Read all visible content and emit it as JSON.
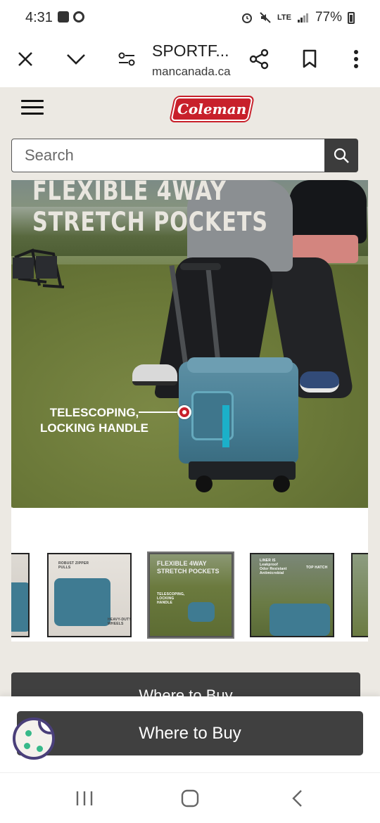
{
  "status_bar": {
    "time": "4:31",
    "network": "LTE",
    "battery": "77%"
  },
  "browser": {
    "page_title": "SPORTF...",
    "url": "mancanada.ca"
  },
  "site": {
    "brand": "Coleman",
    "brand_color": "#c8202b",
    "search_placeholder": "Search"
  },
  "hero": {
    "headline_line1": "FLEXIBLE 4WAY",
    "headline_line2": "STRETCH POCKETS",
    "callout_line1": "TELESCOPING,",
    "callout_line2": "LOCKING HANDLE"
  },
  "thumbnails": [
    {
      "label_1": "",
      "label_2": "",
      "label_3": ""
    },
    {
      "label_1": "ROBUST ZIPPER PULLS",
      "label_2": "HEAVY-DUTY WHEELS"
    },
    {
      "label_1": "FLEXIBLE 4WAY",
      "label_2": "STRETCH POCKETS",
      "label_3": "TELESCOPING, LOCKING HANDLE"
    },
    {
      "label_1": "LINER IS",
      "label_2": "Leakproof",
      "label_3": "Odor Resistant",
      "label_4": "Antimicrobial",
      "label_5": "TOP HATCH"
    },
    {
      "label_1": ""
    }
  ],
  "buttons": {
    "where_to_buy": "Where to Buy",
    "where_to_buy_sticky": "Where to Buy"
  },
  "colors": {
    "button_bg": "#404040",
    "page_bg": "#ece9e3",
    "cookie_accent": "#37b98a"
  }
}
